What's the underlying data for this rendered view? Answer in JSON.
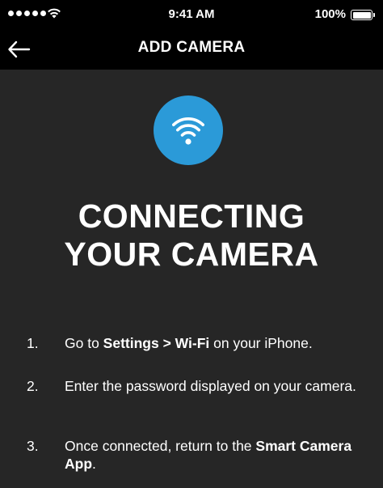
{
  "status_bar": {
    "time": "9:41 AM",
    "battery": "100%",
    "icons": [
      "signal-dots-icon",
      "wifi-icon",
      "battery-icon"
    ]
  },
  "nav": {
    "back_icon": "back-arrow-icon",
    "title": "ADD CAMERA"
  },
  "main": {
    "status_icon": "wifi-icon",
    "status_icon_color": "#2b9ad8",
    "heading_line1": "CONNECTING",
    "heading_line2": "YOUR CAMERA",
    "steps": [
      {
        "number": "1.",
        "parts": [
          "Go to ",
          "Settings",
          " > ",
          "Wi-Fi",
          " on your iPhone."
        ]
      },
      {
        "number": "2.",
        "parts": [
          "Enter the password displayed on your camera."
        ]
      },
      {
        "number": "3.",
        "parts": [
          "Once connected, return to the ",
          "Smart Camera App",
          "."
        ]
      }
    ]
  },
  "colors": {
    "background": "#262626",
    "bars": "#000000",
    "accent": "#2b9ad8",
    "text": "#ffffff"
  }
}
